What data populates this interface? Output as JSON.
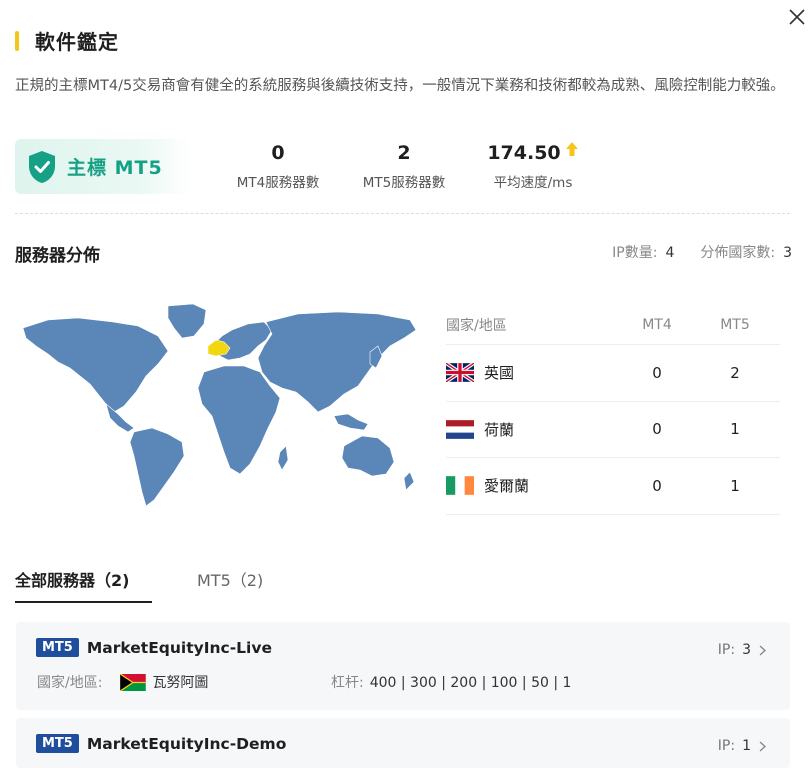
{
  "header": {
    "title": "軟件鑑定",
    "description": "正規的主標MT4/5交易商會有健全的系統服務與後續技術支持，一般情況下業務和技術都較為成熟、風險控制能力較強。"
  },
  "badge": {
    "label": "主標 MT5",
    "icon": "shield-check-icon",
    "color": "#16a085"
  },
  "stats": [
    {
      "value": "0",
      "label": "MT4服務器數"
    },
    {
      "value": "2",
      "label": "MT5服務器數"
    },
    {
      "value": "174.50",
      "label": "平均速度/ms",
      "icon": "arrow-up-icon"
    }
  ],
  "distribution": {
    "title": "服務器分佈",
    "ip_label": "IP數量:",
    "ip_value": "4",
    "country_label": "分佈國家數:",
    "country_value": "3",
    "map_land_color": "#5b86b8",
    "map_highlight_color": "#f2d60f",
    "columns": [
      "國家/地區",
      "MT4",
      "MT5"
    ],
    "rows": [
      {
        "flag": "uk-flag-icon",
        "country": "英國",
        "mt4": "0",
        "mt5": "2"
      },
      {
        "flag": "netherlands-flag-icon",
        "country": "荷蘭",
        "mt4": "0",
        "mt5": "1"
      },
      {
        "flag": "ireland-flag-icon",
        "country": "愛爾蘭",
        "mt4": "0",
        "mt5": "1"
      }
    ]
  },
  "tabs": [
    {
      "label": "全部服務器（2)",
      "active": true
    },
    {
      "label": "MT5（2)",
      "active": false
    }
  ],
  "servers": [
    {
      "tag": "MT5",
      "name": "MarketEquityInc-Live",
      "ip_label": "IP:",
      "ip_count": "3",
      "country_label": "國家/地區:",
      "country": "瓦努阿圖",
      "leverage_label": "杠杆:",
      "leverage": "400 | 300 | 200 | 100 | 50 | 1"
    },
    {
      "tag": "MT5",
      "name": "MarketEquityInc-Demo",
      "ip_label": "IP:",
      "ip_count": "1"
    }
  ],
  "colors": {
    "accent": "#f5c518",
    "tag_bg": "#1f4e9c"
  }
}
